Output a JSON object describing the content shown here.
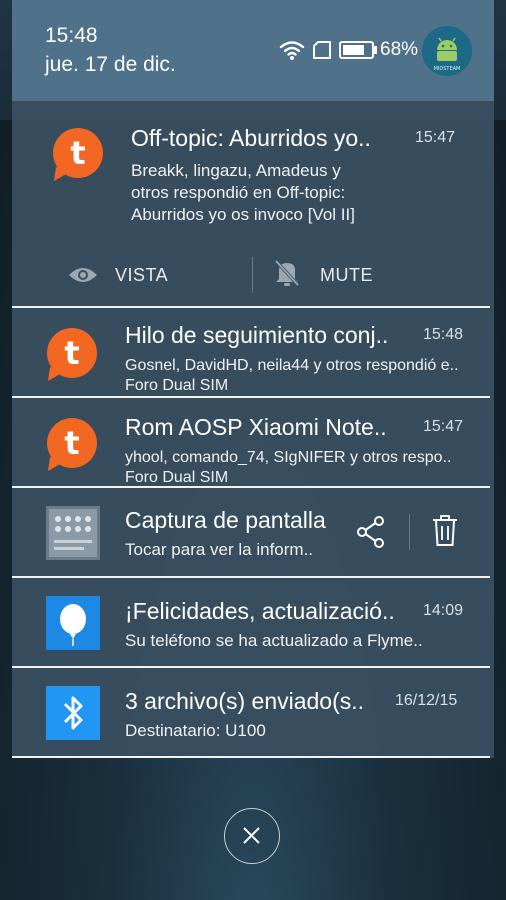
{
  "status_bar": {
    "time": "15:48",
    "date": "jue. 17 de dic.",
    "battery_percent": "68%",
    "avatar_caption": "MIDSTEAM"
  },
  "notifications": [
    {
      "title": "Off-topic: Aburridos yo..",
      "time": "15:47",
      "body_lines": [
        "Breakk, lingazu, Amadeus y",
        "otros respondió en Off-topic:",
        "Aburridos yo os invoco [Vol II]"
      ],
      "actions": [
        {
          "label": "VISTA",
          "icon": "eye-icon"
        },
        {
          "label": "MUTE",
          "icon": "bell-off-icon"
        }
      ]
    },
    {
      "title": "Hilo de seguimiento conj..",
      "time": "15:48",
      "body": "Gosnel, DavidHD, neila44 y otros respondió e..",
      "sub": "Foro Dual SIM"
    },
    {
      "title": "Rom AOSP Xiaomi Note..",
      "time": "15:47",
      "body": "yhool, comando_74, SIgNIFER y otros respo..",
      "sub": "Foro Dual SIM"
    },
    {
      "title": "Captura de pantalla",
      "body": "Tocar para ver la inform.."
    },
    {
      "title": "¡Felicidades, actualizació..",
      "time": "14:09",
      "body": "Su teléfono se ha actualizado a Flyme.."
    },
    {
      "title": "3 archivo(s) enviado(s..",
      "time": "16/12/15",
      "body": "Destinatario: U100"
    }
  ],
  "colors": {
    "tapatalk_orange": "#f26722",
    "flyme_blue": "#1e88e5",
    "bluetooth_blue": "#2196f3",
    "panel": "#3a5061",
    "header": "#4f7189"
  }
}
